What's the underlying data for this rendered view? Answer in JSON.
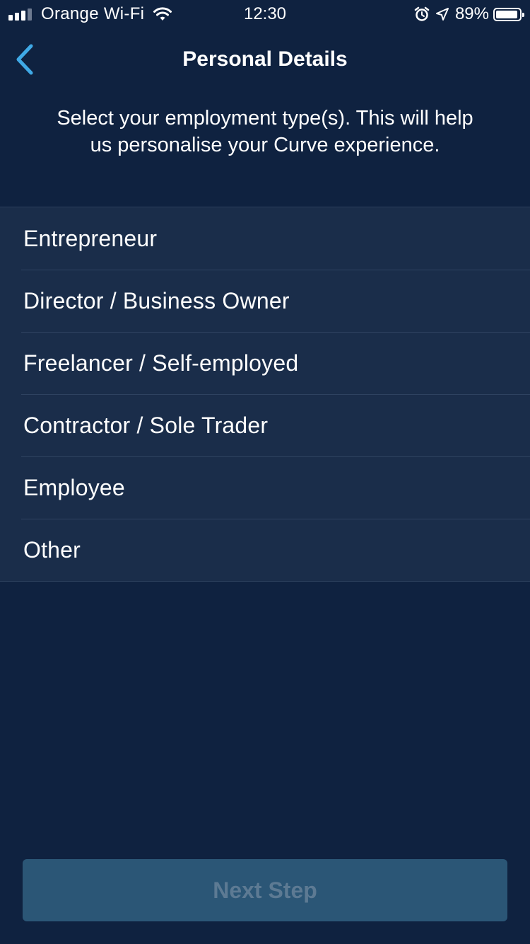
{
  "status_bar": {
    "carrier": "Orange Wi-Fi",
    "time": "12:30",
    "battery_percent": "89%",
    "icons": [
      "signal-icon",
      "wifi-icon",
      "alarm-icon",
      "location-arrow-icon",
      "battery-icon"
    ]
  },
  "nav": {
    "title": "Personal Details",
    "back_icon": "chevron-left-icon"
  },
  "description": "Select your employment type(s). This will help us personalise your Curve experience.",
  "options": [
    {
      "label": "Entrepreneur"
    },
    {
      "label": "Director / Business Owner"
    },
    {
      "label": "Freelancer / Self-employed"
    },
    {
      "label": "Contractor / Sole Trader"
    },
    {
      "label": "Employee"
    },
    {
      "label": "Other"
    }
  ],
  "next_button": {
    "label": "Next Step",
    "state": "disabled"
  },
  "colors": {
    "background": "#0f2240",
    "list_background": "#1a2d4a",
    "accent": "#3fa9e6",
    "button_background": "#2b5676",
    "button_text_disabled": "#5d7a93"
  }
}
